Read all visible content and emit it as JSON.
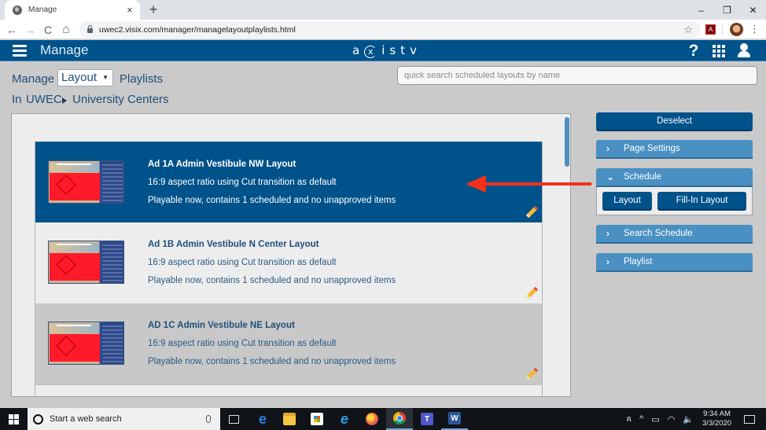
{
  "browser": {
    "tab_title": "Manage",
    "tab_close": "×",
    "new_tab": "+",
    "window_controls": {
      "minimize": "–",
      "restore": "❐",
      "close": "✕"
    },
    "nav": {
      "back": "←",
      "forward": "→",
      "reload": "C",
      "home": "⌂"
    },
    "url": "uwec2.visix.com/manager/managelayoutplaylists.html",
    "bookmark_icon": "☆",
    "extension_label": "A",
    "menu_icon": "⋮"
  },
  "header": {
    "title": "Manage",
    "logo": {
      "a": "a",
      "x": "x",
      "rest": "istv"
    },
    "help_icon": "?"
  },
  "toolbar": {
    "manage_label": "Manage",
    "type_select": {
      "value": "Layout",
      "caret": "▼"
    },
    "playlists_label": "Playlists",
    "search_placeholder": "quick search scheduled layouts by name",
    "search_value": ""
  },
  "breadcrumb": {
    "prefix": "In",
    "items": [
      "UWEC",
      "University Centers"
    ]
  },
  "layouts": [
    {
      "name": "Ad 1A Admin Vestibule NW Layout",
      "aspect": "16:9 aspect ratio using Cut transition as default",
      "status": "Playable now, contains 1 scheduled and no unapproved items",
      "state": "selected"
    },
    {
      "name": "Ad 1B Admin Vestibule N Center Layout",
      "aspect": "16:9 aspect ratio using Cut transition as default",
      "status": "Playable now, contains 1 scheduled and no unapproved items",
      "state": "normal"
    },
    {
      "name": "AD 1C Admin Vestibule NE Layout",
      "aspect": "16:9 aspect ratio using Cut transition as default",
      "status": "Playable now, contains 1 scheduled and no unapproved items",
      "state": "hover"
    }
  ],
  "actions": {
    "deselect": "Deselect",
    "page_settings": {
      "label": "Page Settings",
      "chevron": "›",
      "expanded": false
    },
    "schedule": {
      "label": "Schedule",
      "chevron": "⌄",
      "expanded": true,
      "buttons": {
        "layout": "Layout",
        "fill_in": "Fill-In Layout"
      }
    },
    "search_schedule": {
      "label": "Search Schedule",
      "chevron": "›",
      "expanded": false
    },
    "playlist": {
      "label": "Playlist",
      "chevron": "›",
      "expanded": false
    }
  },
  "taskbar": {
    "search_placeholder": "Start a web search",
    "apps": [
      "task-view",
      "edge",
      "file-explorer",
      "store",
      "internet-explorer",
      "firefox",
      "chrome",
      "teams",
      "word"
    ],
    "active_app": "chrome",
    "app_glyphs": {
      "edge": "e",
      "ie": "e",
      "teams": "T",
      "word": "W"
    },
    "tray": {
      "people": "ጸ",
      "chevron": "^",
      "battery": "▭",
      "wifi": "◠",
      "volume": "🔈"
    },
    "time": "9:34 AM",
    "date": "3/3/2020"
  },
  "colors": {
    "brand_blue": "#00528a",
    "accordion_blue": "#4a90c2",
    "annotation_red": "#f2301c",
    "page_bg": "#cacaca"
  }
}
